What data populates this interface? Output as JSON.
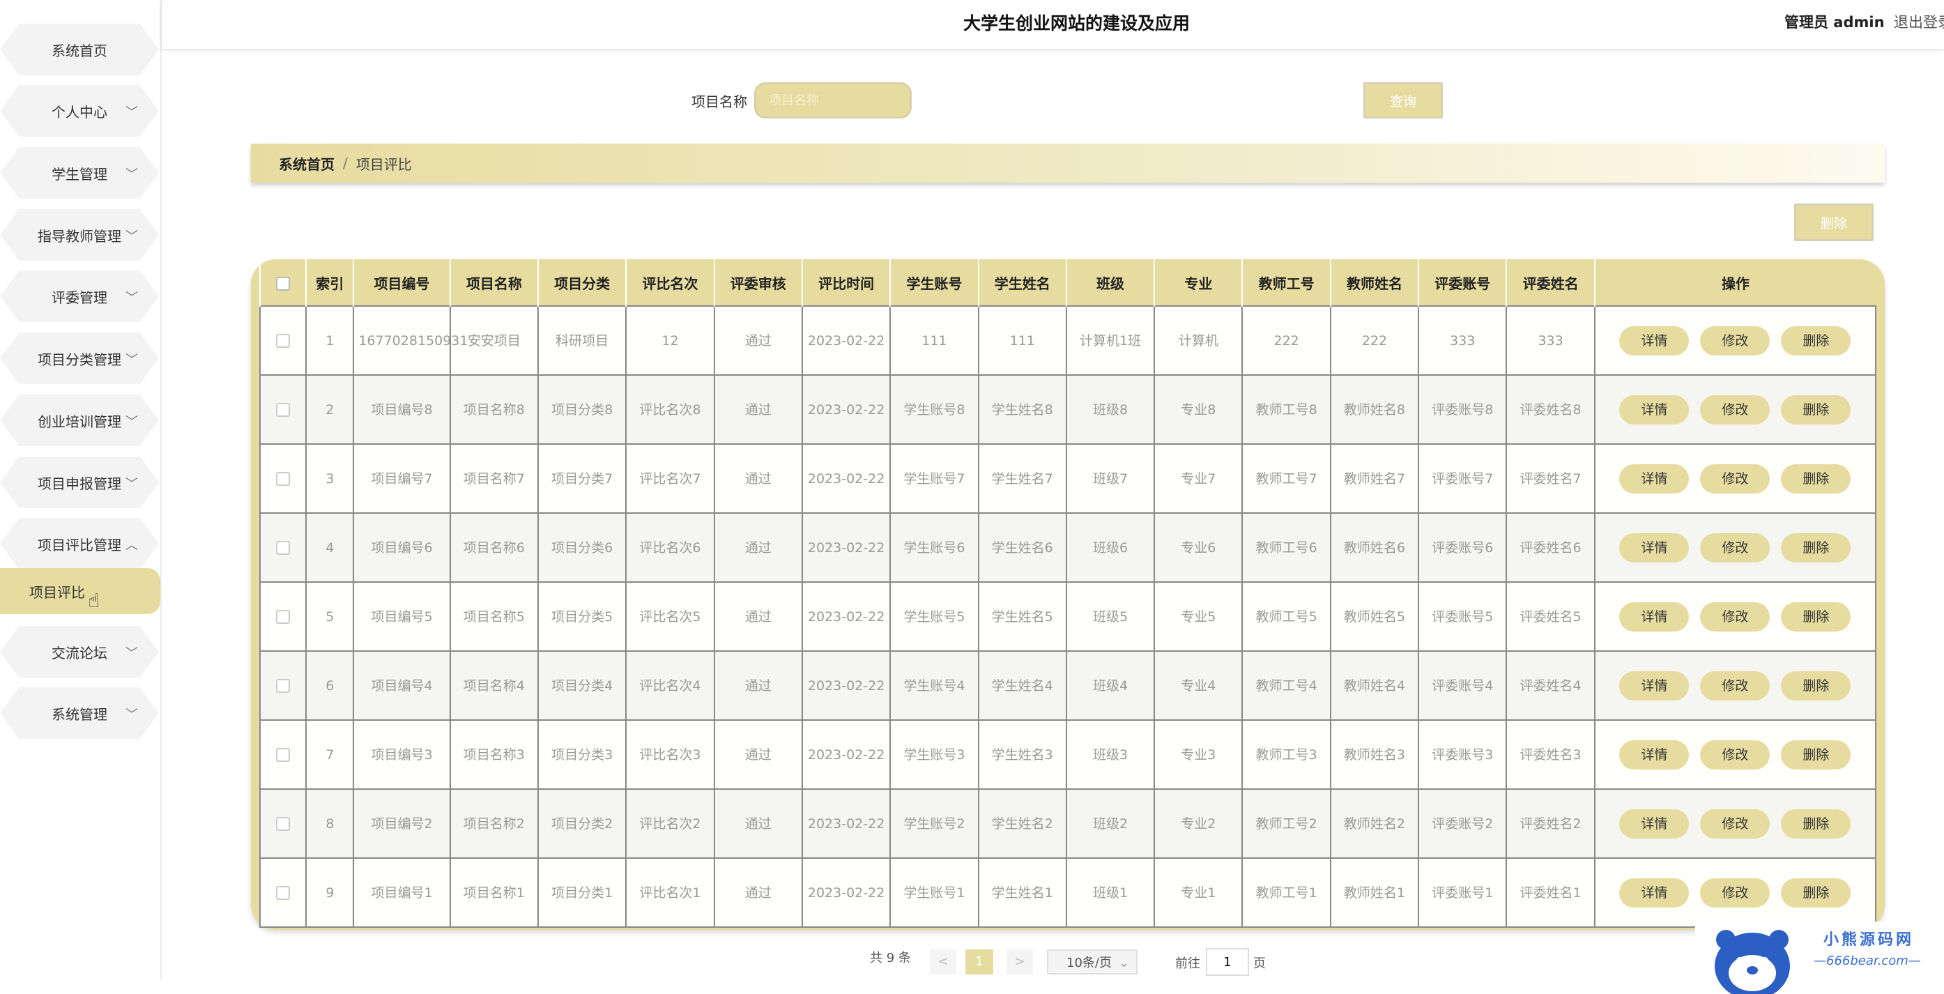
{
  "header": {
    "title": "大学生创业网站的建设及应用",
    "admin": "管理员 admin",
    "logout": "退出登录"
  },
  "sidebar": {
    "items": [
      {
        "label": "系统首页",
        "expandable": false
      },
      {
        "label": "个人中心",
        "expandable": true
      },
      {
        "label": "学生管理",
        "expandable": true
      },
      {
        "label": "指导教师管理",
        "expandable": true
      },
      {
        "label": "评委管理",
        "expandable": true
      },
      {
        "label": "项目分类管理",
        "expandable": true
      },
      {
        "label": "创业培训管理",
        "expandable": true
      },
      {
        "label": "项目申报管理",
        "expandable": true
      },
      {
        "label": "项目评比管理",
        "expandable": true,
        "expanded": true
      },
      {
        "label": "交流论坛",
        "expandable": true
      },
      {
        "label": "系统管理",
        "expandable": true
      }
    ],
    "active_sub": "项目评比"
  },
  "search": {
    "label": "项目名称",
    "placeholder": "项目名称",
    "button": "查询"
  },
  "breadcrumb": {
    "home": "系统首页",
    "separator": "/",
    "current": "项目评比"
  },
  "toolbar": {
    "delete": "删除"
  },
  "table": {
    "columns": [
      "索引",
      "项目编号",
      "项目名称",
      "项目分类",
      "评比名次",
      "评委审核",
      "评比时间",
      "学生账号",
      "学生姓名",
      "班级",
      "专业",
      "教师工号",
      "教师姓名",
      "评委账号",
      "评委姓名",
      "操作"
    ],
    "actions": [
      "详情",
      "修改",
      "删除"
    ],
    "rows": [
      [
        "1",
        "1677028150931",
        "安安项目",
        "科研项目",
        "12",
        "通过",
        "2023-02-22",
        "111",
        "111",
        "计算机1班",
        "计算机",
        "222",
        "222",
        "333",
        "333"
      ],
      [
        "2",
        "项目编号8",
        "项目名称8",
        "项目分类8",
        "评比名次8",
        "通过",
        "2023-02-22",
        "学生账号8",
        "学生姓名8",
        "班级8",
        "专业8",
        "教师工号8",
        "教师姓名8",
        "评委账号8",
        "评委姓名8"
      ],
      [
        "3",
        "项目编号7",
        "项目名称7",
        "项目分类7",
        "评比名次7",
        "通过",
        "2023-02-22",
        "学生账号7",
        "学生姓名7",
        "班级7",
        "专业7",
        "教师工号7",
        "教师姓名7",
        "评委账号7",
        "评委姓名7"
      ],
      [
        "4",
        "项目编号6",
        "项目名称6",
        "项目分类6",
        "评比名次6",
        "通过",
        "2023-02-22",
        "学生账号6",
        "学生姓名6",
        "班级6",
        "专业6",
        "教师工号6",
        "教师姓名6",
        "评委账号6",
        "评委姓名6"
      ],
      [
        "5",
        "项目编号5",
        "项目名称5",
        "项目分类5",
        "评比名次5",
        "通过",
        "2023-02-22",
        "学生账号5",
        "学生姓名5",
        "班级5",
        "专业5",
        "教师工号5",
        "教师姓名5",
        "评委账号5",
        "评委姓名5"
      ],
      [
        "6",
        "项目编号4",
        "项目名称4",
        "项目分类4",
        "评比名次4",
        "通过",
        "2023-02-22",
        "学生账号4",
        "学生姓名4",
        "班级4",
        "专业4",
        "教师工号4",
        "教师姓名4",
        "评委账号4",
        "评委姓名4"
      ],
      [
        "7",
        "项目编号3",
        "项目名称3",
        "项目分类3",
        "评比名次3",
        "通过",
        "2023-02-22",
        "学生账号3",
        "学生姓名3",
        "班级3",
        "专业3",
        "教师工号3",
        "教师姓名3",
        "评委账号3",
        "评委姓名3"
      ],
      [
        "8",
        "项目编号2",
        "项目名称2",
        "项目分类2",
        "评比名次2",
        "通过",
        "2023-02-22",
        "学生账号2",
        "学生姓名2",
        "班级2",
        "专业2",
        "教师工号2",
        "教师姓名2",
        "评委账号2",
        "评委姓名2"
      ],
      [
        "9",
        "项目编号1",
        "项目名称1",
        "项目分类1",
        "评比名次1",
        "通过",
        "2023-02-22",
        "学生账号1",
        "学生姓名1",
        "班级1",
        "专业1",
        "教师工号1",
        "教师姓名1",
        "评委账号1",
        "评委姓名1"
      ]
    ]
  },
  "pagination": {
    "total": "共 9 条",
    "prev": "<",
    "current_page": "1",
    "next": ">",
    "page_size": "10条/页",
    "goto_label": "前往",
    "goto_value": "1",
    "goto_unit": "页"
  },
  "watermark": {
    "name": "小熊源码网",
    "url": "—666bear.com—"
  },
  "colors": {
    "accent": "#e7dca0",
    "menu_bg": "#f3f3f3",
    "brand_blue": "#3b6fd0"
  }
}
